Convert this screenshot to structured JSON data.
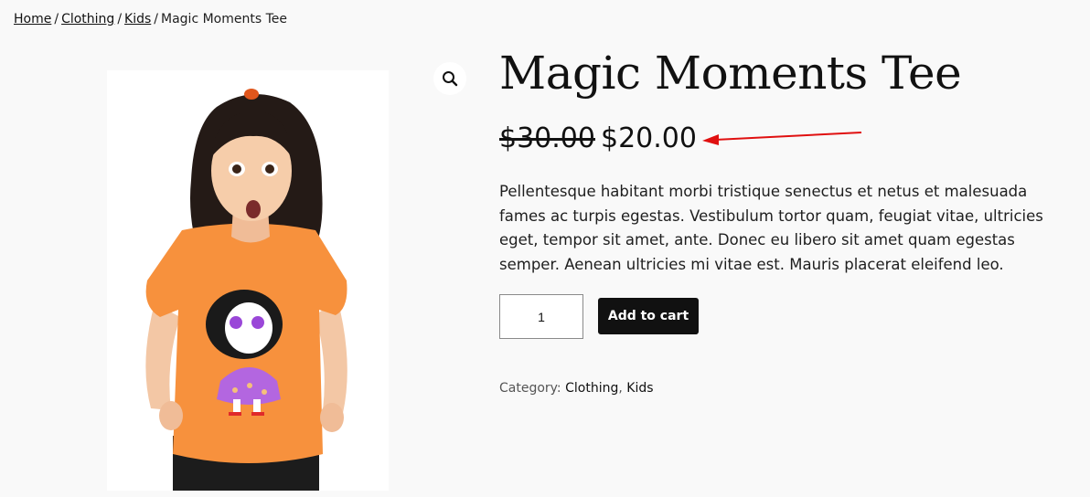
{
  "breadcrumb": {
    "home": "Home",
    "clothing": "Clothing",
    "kids": "Kids",
    "separator": "/",
    "current": "Magic Moments Tee"
  },
  "product": {
    "title": "Magic Moments Tee",
    "regular_price": "$30.00",
    "sale_price": "$20.00",
    "description": "Pellentesque habitant morbi tristique senectus et netus et malesuada fames ac turpis egestas. Vestibulum tortor quam, feugiat vitae, ultricies eget, tempor sit amet, ante. Donec eu libero sit amet quam egestas semper. Aenean ultricies mi vitae est. Mauris placerat eleifend leo.",
    "quantity": "1",
    "add_to_cart_label": "Add to cart",
    "category_label": "Category:",
    "category_1": "Clothing",
    "category_sep": ",",
    "category_2": "Kids"
  },
  "icons": {
    "zoom": "magnifier-icon",
    "annotation": "red-arrow-icon"
  },
  "colors": {
    "accent_button": "#111111",
    "annotation_arrow": "#e01010",
    "tee": "#f7913d"
  }
}
